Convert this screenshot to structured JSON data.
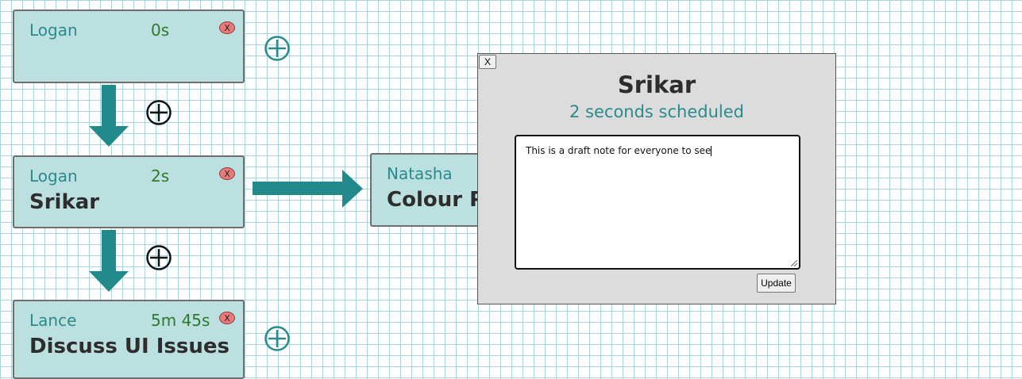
{
  "cards": [
    {
      "owner": "Logan",
      "time": "0s",
      "title": "",
      "delete_label": "X"
    },
    {
      "owner": "Logan",
      "time": "2s",
      "title": "Srikar",
      "delete_label": "X"
    },
    {
      "owner": "Natasha",
      "time": "",
      "title": "Colour Pa",
      "delete_label": ""
    },
    {
      "owner": "Lance",
      "time": "5m 45s",
      "title": "Discuss UI Issues",
      "delete_label": "X"
    }
  ],
  "modal": {
    "close_label": "X",
    "title": "Srikar",
    "subtitle": "2 seconds scheduled",
    "note_value": "This is a draft note for everyone to see",
    "update_label": "Update"
  },
  "colors": {
    "card_bg": "#bcdfe0",
    "accent_teal": "#2b8a8c",
    "time_green": "#2d7a2d",
    "delete_red": "#e87a7a",
    "grid": "#a8d4e0"
  },
  "icons": {
    "add_teal": "plus-circle-icon",
    "add_black": "plus-circle-icon",
    "arrow_down": "arrow-down-icon",
    "arrow_right": "arrow-right-icon"
  }
}
